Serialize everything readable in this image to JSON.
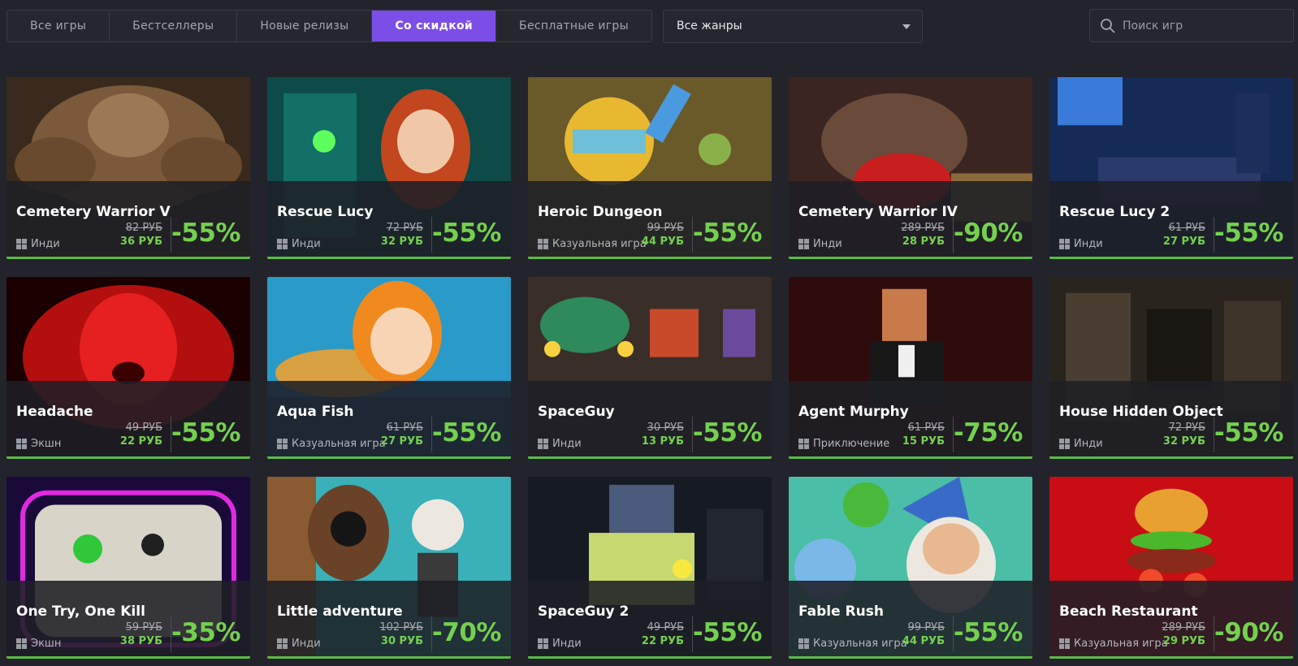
{
  "tabs": [
    "Все игры",
    "Бестселлеры",
    "Новые релизы",
    "Со скидкой",
    "Бесплатные игры"
  ],
  "active_tab": "Со скидкой",
  "genre_filter": {
    "selected": "Все жанры"
  },
  "search": {
    "placeholder": "Поиск игр"
  },
  "colors": {
    "accent": "#7b4ee8",
    "discount": "#74d14e",
    "background": "#23242b"
  },
  "games": [
    {
      "title": "Cemetery Warrior V",
      "genre": "Инди",
      "old_price": "82 РУБ",
      "new_price": "36 РУБ",
      "discount": "-55%"
    },
    {
      "title": "Rescue Lucy",
      "genre": "Инди",
      "old_price": "72 РУБ",
      "new_price": "32 РУБ",
      "discount": "-55%"
    },
    {
      "title": "Heroic Dungeon",
      "genre": "Казуальная игра",
      "old_price": "99 РУБ",
      "new_price": "44 РУБ",
      "discount": "-55%"
    },
    {
      "title": "Cemetery Warrior IV",
      "genre": "Инди",
      "old_price": "289 РУБ",
      "new_price": "28 РУБ",
      "discount": "-90%"
    },
    {
      "title": "Rescue Lucy 2",
      "genre": "Инди",
      "old_price": "61 РУБ",
      "new_price": "27 РУБ",
      "discount": "-55%"
    },
    {
      "title": "Headache",
      "genre": "Экшн",
      "old_price": "49 РУБ",
      "new_price": "22 РУБ",
      "discount": "-55%"
    },
    {
      "title": "Aqua Fish",
      "genre": "Казуальная игра",
      "old_price": "61 РУБ",
      "new_price": "27 РУБ",
      "discount": "-55%"
    },
    {
      "title": "SpaceGuy",
      "genre": "Инди",
      "old_price": "30 РУБ",
      "new_price": "13 РУБ",
      "discount": "-55%"
    },
    {
      "title": "Agent Murphy",
      "genre": "Приключение",
      "old_price": "61 РУБ",
      "new_price": "15 РУБ",
      "discount": "-75%"
    },
    {
      "title": "House Hidden Object",
      "genre": "Инди",
      "old_price": "72 РУБ",
      "new_price": "32 РУБ",
      "discount": "-55%"
    },
    {
      "title": "One Try, One Kill",
      "genre": "Экшн",
      "old_price": "59 РУБ",
      "new_price": "38 РУБ",
      "discount": "-35%"
    },
    {
      "title": "Little adventure",
      "genre": "Инди",
      "old_price": "102 РУБ",
      "new_price": "30 РУБ",
      "discount": "-70%"
    },
    {
      "title": "SpaceGuy 2",
      "genre": "Инди",
      "old_price": "49 РУБ",
      "new_price": "22 РУБ",
      "discount": "-55%"
    },
    {
      "title": "Fable Rush",
      "genre": "Казуальная игра",
      "old_price": "99 РУБ",
      "new_price": "44 РУБ",
      "discount": "-55%"
    },
    {
      "title": "Beach Restaurant",
      "genre": "Казуальная игра",
      "old_price": "289 РУБ",
      "new_price": "29 РУБ",
      "discount": "-90%"
    }
  ]
}
